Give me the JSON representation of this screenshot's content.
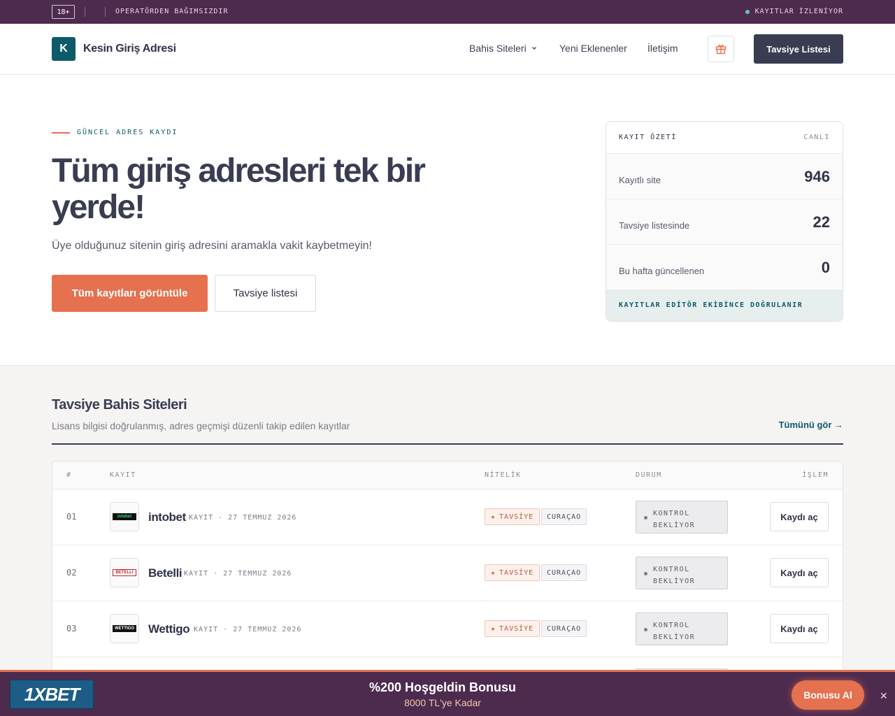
{
  "topstrip": {
    "age": "18+",
    "notice": "OPERATÖRDEN BAĞIMSIZDIR",
    "status": "KAYITLAR İZLENİYOR"
  },
  "header": {
    "logo_letter": "K",
    "brand": "Kesin Giriş Adresi",
    "nav": [
      "Bahis Siteleri",
      "Yeni Eklenenler",
      "İletişim"
    ],
    "cta": "Tavsiye Listesi"
  },
  "hero": {
    "eyebrow": "GÜNCEL ADRES KAYDI",
    "title": "Tüm giriş adresleri tek bir yerde!",
    "subtitle": "Üye olduğunuz sitenin giriş adresini aramakla vakit kaybetmeyin!",
    "primary_button": "Tüm kayıtları görüntüle",
    "secondary_button": "Tavsiye listesi"
  },
  "summary": {
    "title": "KAYIT ÖZETİ",
    "badge": "CANLI",
    "rows": [
      {
        "label": "Kayıtlı site",
        "value": "946"
      },
      {
        "label": "Tavsiye listesinde",
        "value": "22"
      },
      {
        "label": "Bu hafta güncellenen",
        "value": "0"
      }
    ],
    "footer": "KAYITLAR EDİTÖR EKİBİNCE DOĞRULANIR"
  },
  "section": {
    "title": "Tavsiye Bahis Siteleri",
    "subtitle": "Lisans bilgisi doğrulanmış, adres geçmişi düzenli takip edilen kayıtlar",
    "see_all": "Tümünü gör →",
    "columns": [
      "#",
      "KAYIT",
      "NİTELİK",
      "DURUM",
      "İŞLEM"
    ],
    "rows": [
      {
        "num": "01",
        "name": "intobet",
        "meta": "KAYIT · 27 TEMMUZ 2026",
        "tag": "TAVSİYE",
        "license": "CURAÇAO",
        "status1": "KONTROL",
        "status2": "BEKLİYOR",
        "action": "Kaydı aç",
        "logo_text": "intobet"
      },
      {
        "num": "02",
        "name": "Betelli",
        "meta": "KAYIT · 27 TEMMUZ 2026",
        "tag": "TAVSİYE",
        "license": "CURAÇAO",
        "status1": "KONTROL",
        "status2": "BEKLİYOR",
        "action": "Kaydı aç",
        "logo_text": "BETELLI"
      },
      {
        "num": "03",
        "name": "Wettigo",
        "meta": "KAYIT · 27 TEMMUZ 2026",
        "tag": "TAVSİYE",
        "license": "CURAÇAO",
        "status1": "KONTROL",
        "status2": "BEKLİYOR",
        "action": "Kaydı aç",
        "logo_text": "WETTIGO"
      }
    ]
  },
  "bonus_bar": {
    "logo": "1XBET",
    "title": "%200 Hoşgeldin Bonusu",
    "subtitle": "8000 TL'ye Kadar",
    "button": "Bonusu Al",
    "close": "✕"
  }
}
